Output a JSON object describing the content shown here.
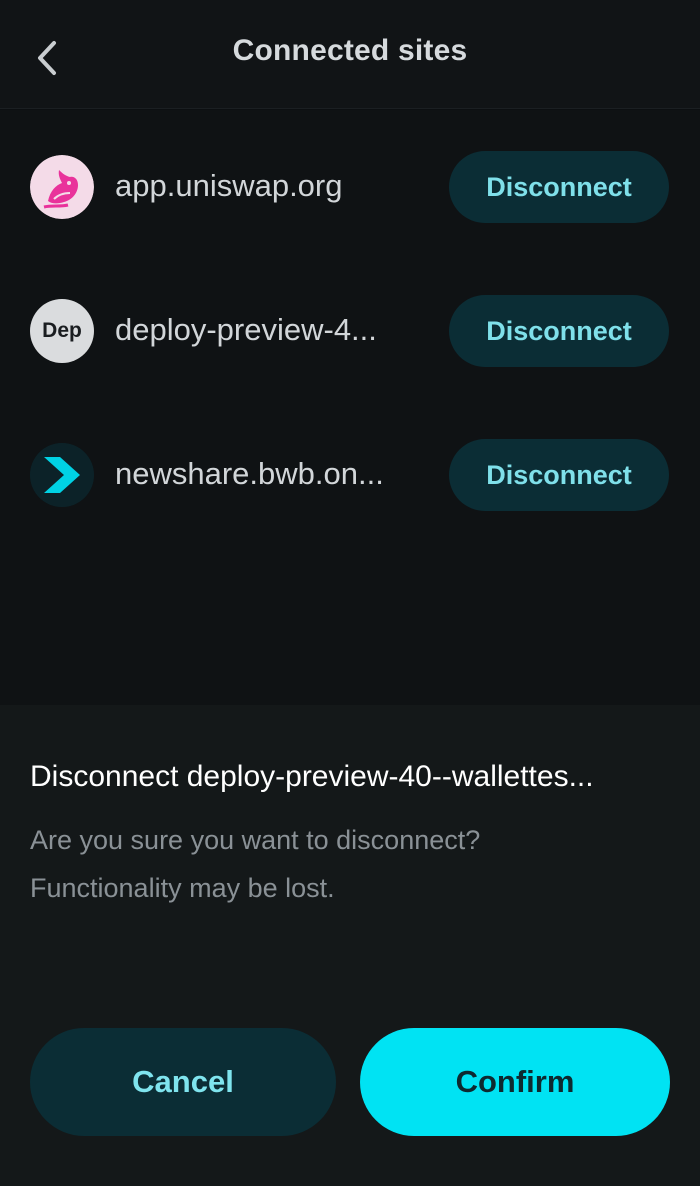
{
  "header": {
    "title": "Connected sites",
    "back_icon": "chevron-left-icon"
  },
  "sites": [
    {
      "domain": "app.uniswap.org",
      "logo": "uniswap-logo",
      "button": "Disconnect"
    },
    {
      "domain": "deploy-preview-4...",
      "logo_text": "Dep",
      "button": "Disconnect"
    },
    {
      "domain": "newshare.bwb.on...",
      "logo": "bwb-chevron-logo",
      "button": "Disconnect"
    }
  ],
  "dialog": {
    "title": "Disconnect deploy-preview-40--wallettes...",
    "line1": "Are you sure you want to disconnect?",
    "line2": "Functionality may be lost.",
    "cancel_label": "Cancel",
    "confirm_label": "Confirm"
  },
  "colors": {
    "accent": "#00e3f3",
    "button_dark": "#0b2d35",
    "background": "#0c0f11"
  }
}
